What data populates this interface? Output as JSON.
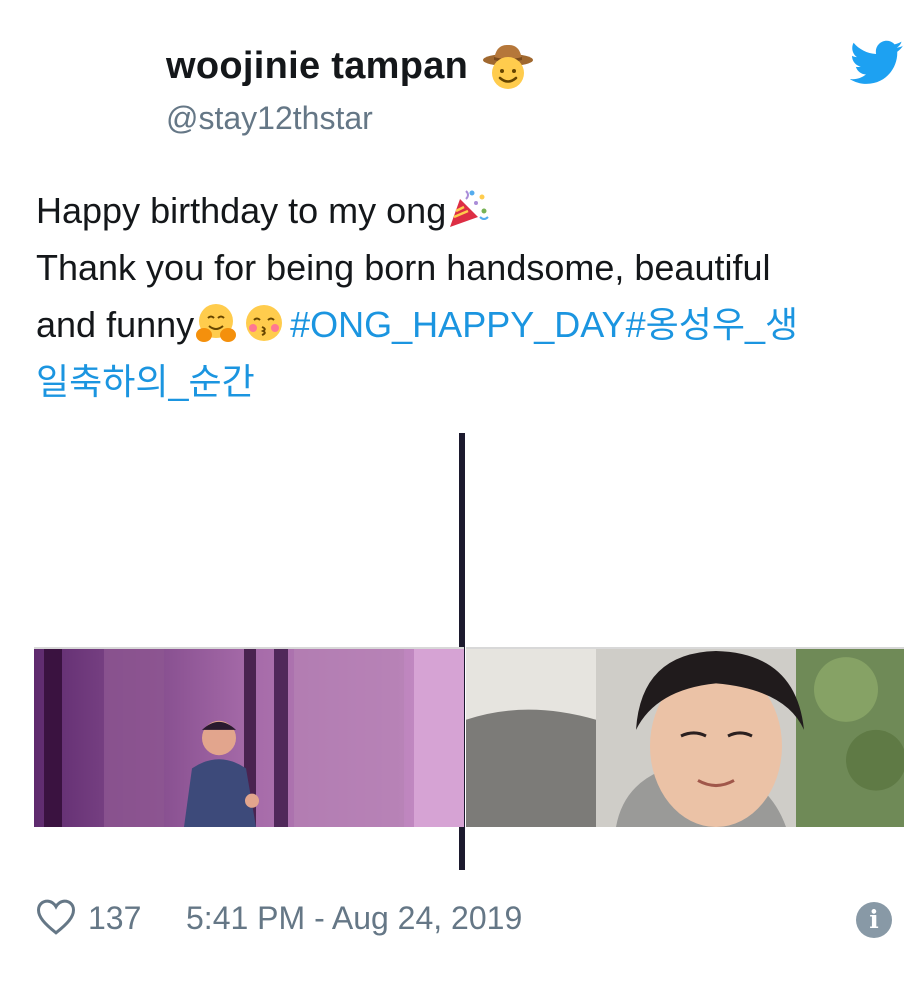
{
  "author": {
    "display_name": "woojinie tampan",
    "handle": "@stay12thstar",
    "name_emoji": "cowboy-hat-face-emoji"
  },
  "tweet": {
    "line1": "Happy birthday to my ong",
    "line2": "Thank you for being born handsome, beautiful",
    "line3_text": "and funny",
    "hashtag1": "#ONG_HAPPY_DAY",
    "hashtag2_part1": "#옹성우_생",
    "hashtag2_part2": "일축하의_순간"
  },
  "footer": {
    "likes": "137",
    "timestamp": "5:41 PM - Aug 24, 2019"
  },
  "colors": {
    "hashtag": "#1b95e0",
    "twitter_blue": "#1da1f2",
    "meta_gray": "#657786"
  }
}
